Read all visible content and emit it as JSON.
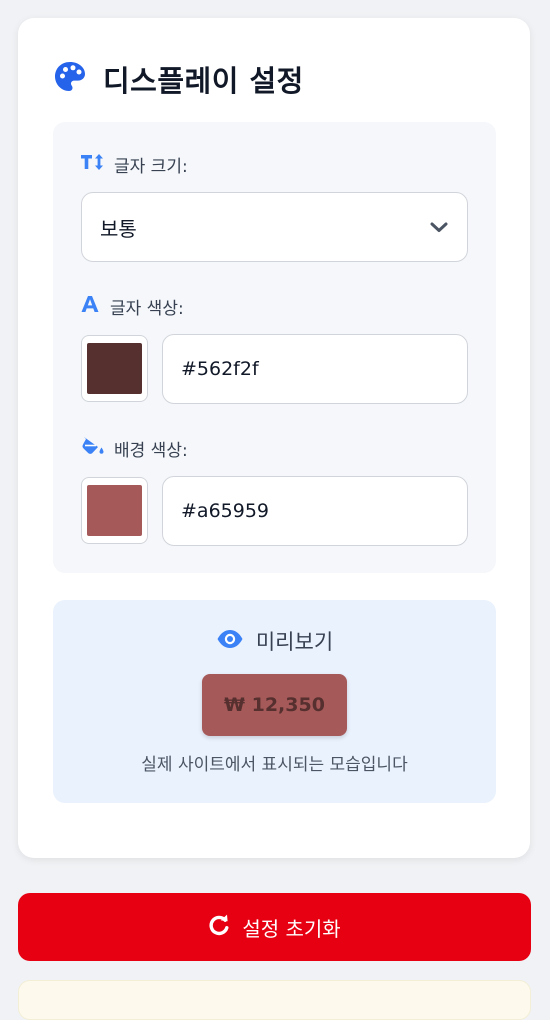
{
  "header": {
    "title": "디스플레이 설정",
    "icon": "palette-icon"
  },
  "font_size": {
    "label": "글자 크기:",
    "icon": "text-size-icon",
    "selected": "보통"
  },
  "font_color": {
    "label": "글자 색상:",
    "icon": "font-a-icon",
    "value": "#562f2f",
    "swatch": "#562f2f"
  },
  "bg_color": {
    "label": "배경 색상:",
    "icon": "paint-bucket-icon",
    "value": "#a65959",
    "swatch": "#a65959"
  },
  "preview": {
    "title": "미리보기",
    "icon": "eye-icon",
    "sample_text": "₩ 12,350",
    "caption": "실제 사이트에서 표시되는 모습입니다"
  },
  "reset": {
    "label": "설정 초기화",
    "icon": "reset-icon",
    "color": "#e60012"
  },
  "colors": {
    "accent": "#3b82f6",
    "page_bg": "#f0f2f5"
  }
}
